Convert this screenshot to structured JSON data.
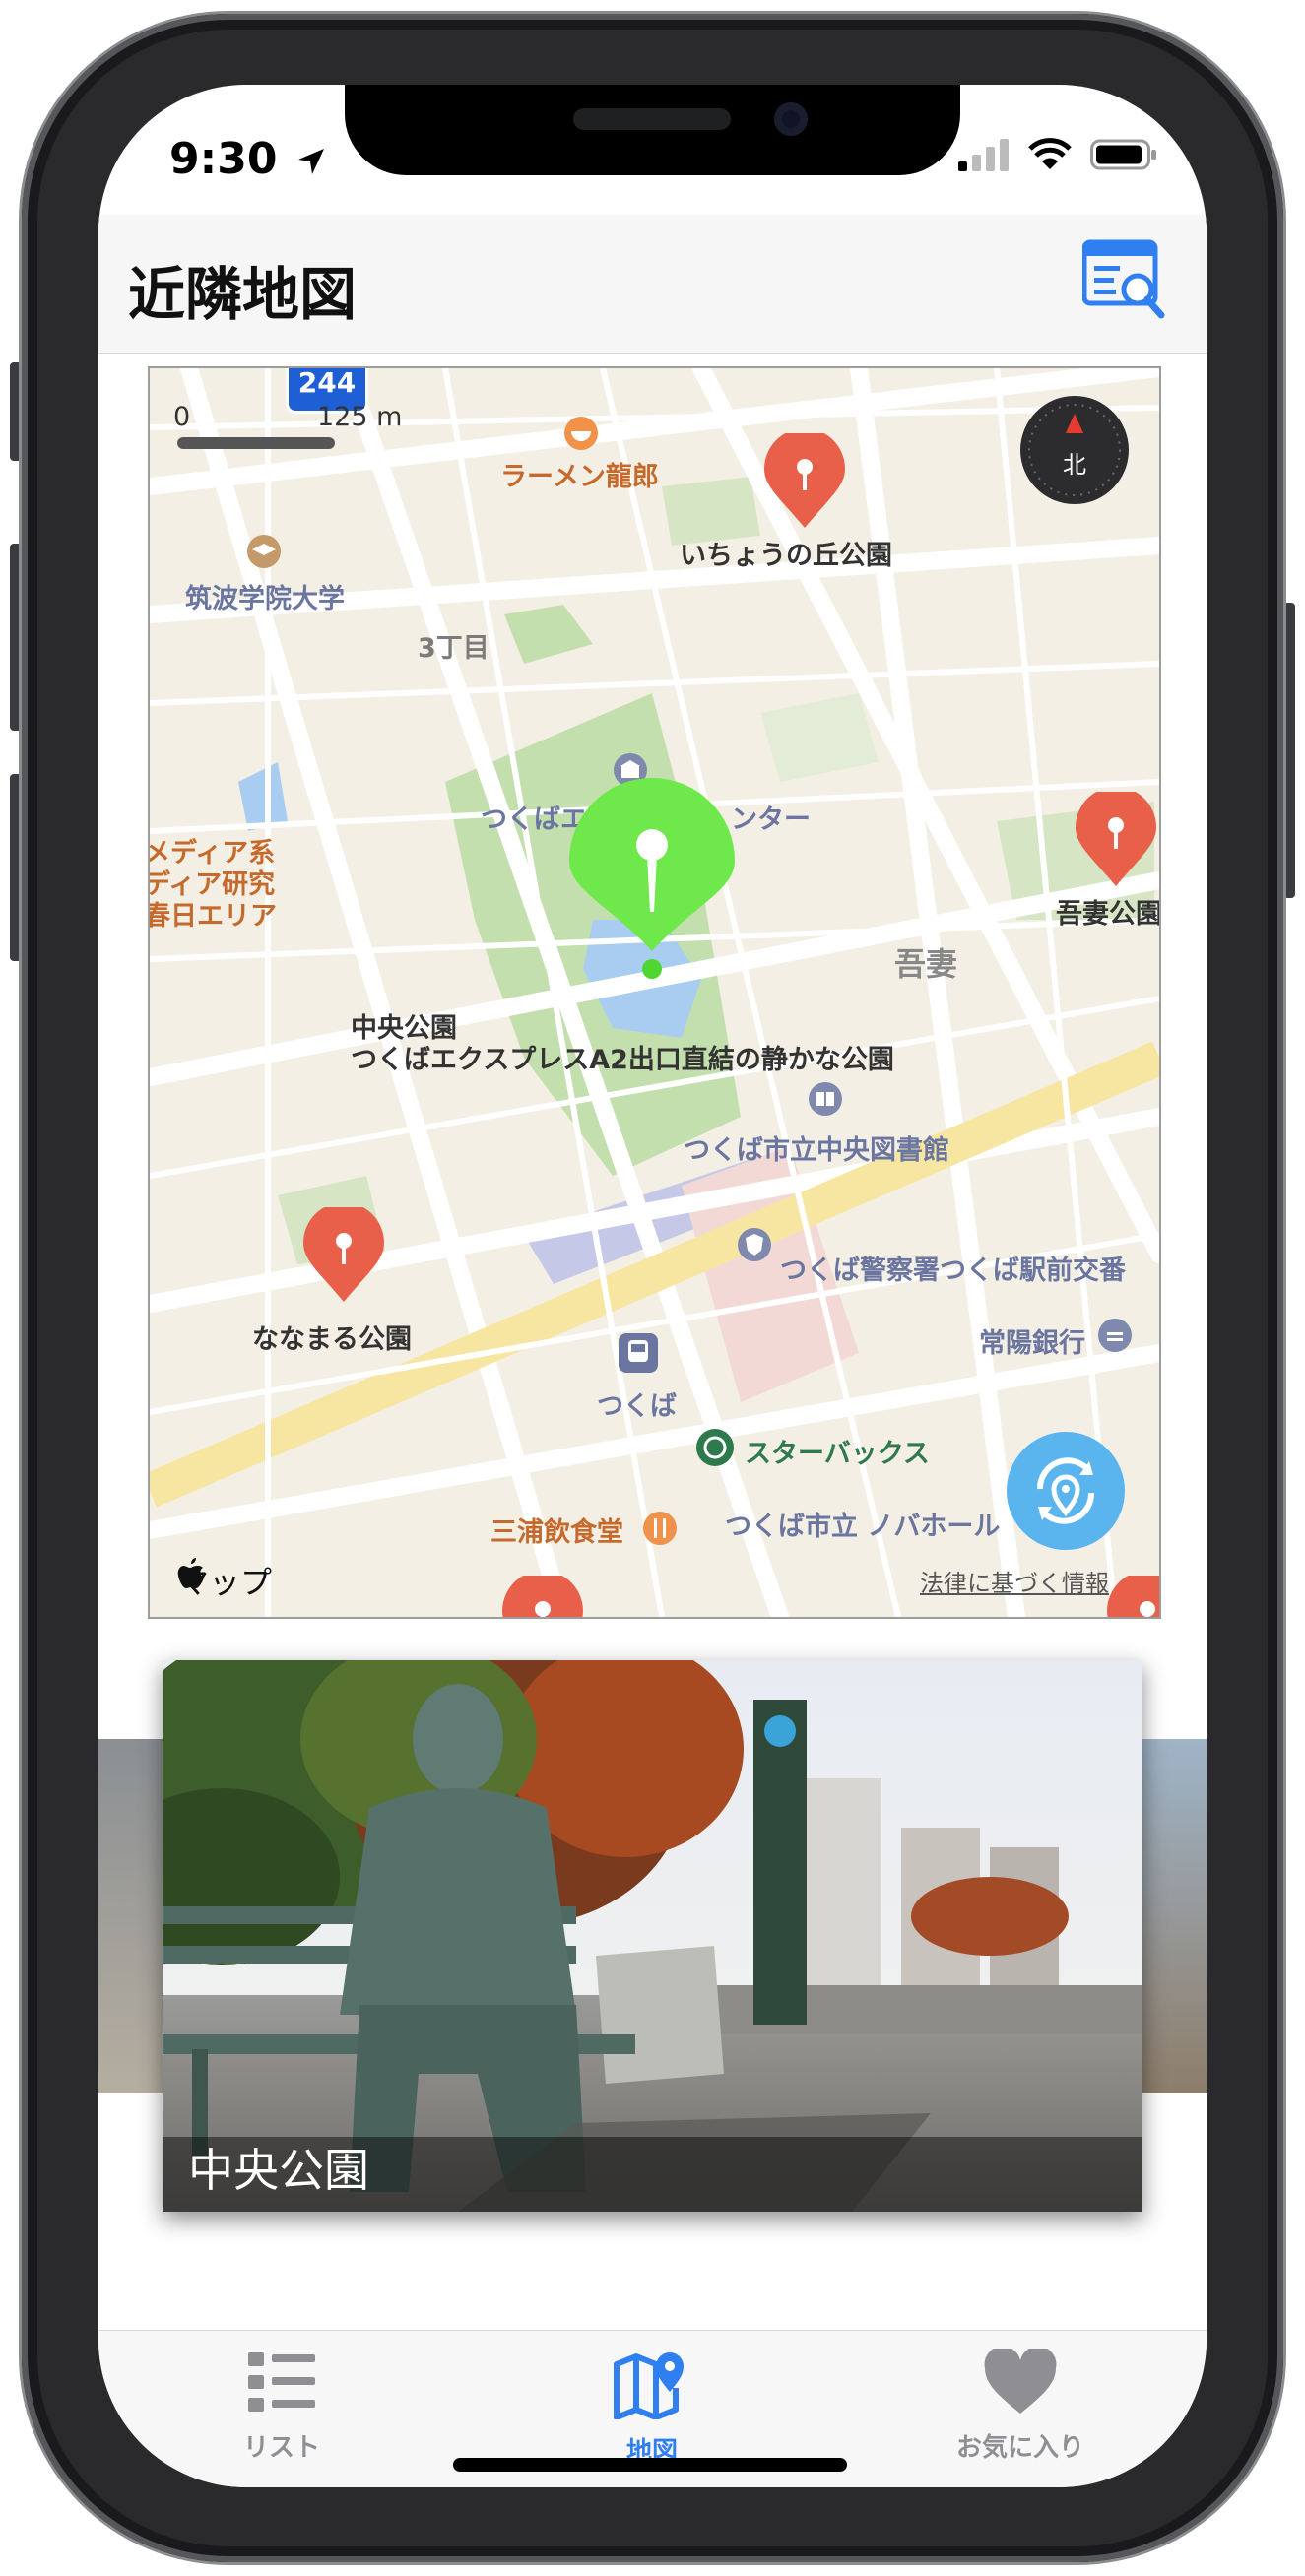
{
  "status_bar": {
    "time": "9:30"
  },
  "header": {
    "title": "近隣地図"
  },
  "map": {
    "route_shield": "244",
    "scale": {
      "zero": "0",
      "distance": "125 m"
    },
    "compass_label": "北",
    "labels": {
      "ramen": "ラーメン龍郎",
      "icho_park": "いちょうの丘公園",
      "university": "筑波学院大学",
      "chome": "3丁目",
      "center": "つくばエ",
      "center_tail": "ンター",
      "media_1": "メディア系",
      "media_2": "ディア研究",
      "media_3": "春日エリア",
      "azuma_park": "吾妻公園",
      "azuma": "吾妻",
      "chuo_park": "中央公園",
      "chuo_park_desc": "つくばエクスプレスA2出口直結の静かな公園",
      "library": "つくば市立中央図書館",
      "police": "つくば警察署つくば駅前交番",
      "nanamaru_park": "ななまる公園",
      "joyo_bank": "常陽銀行",
      "tsukuba_station": "つくば",
      "starbucks": "スターバックス",
      "miura": "三浦飲食堂",
      "nova_hall": "つくば市立 ノバホール"
    },
    "brand": "マップ",
    "legal": "法律に基づく情報"
  },
  "carousel": {
    "current_card_title": "中央公園"
  },
  "tab_bar": {
    "list_label": "リスト",
    "map_label": "地図",
    "favorites_label": "お気に入り"
  },
  "colors": {
    "accent": "#2f7ff0",
    "pin_red": "#e8604a",
    "pin_green": "#6ee84a",
    "tab_inactive": "#8e8e93"
  }
}
